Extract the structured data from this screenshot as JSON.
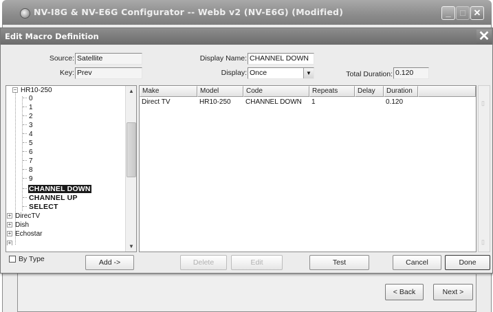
{
  "parent_window": {
    "title": "NV-I8G & NV-E6G Configurator -- Webb v2 (NV-E6G) (Modified)",
    "back_label": "< Back",
    "next_label": "Next >",
    "close_glyph": "✕"
  },
  "dialog": {
    "title": "Edit Macro Definition",
    "close_glyph": "✕",
    "source_label": "Source:",
    "source_value": "Satellite",
    "key_label": "Key:",
    "key_value": "Prev",
    "display_name_label": "Display Name:",
    "display_name_value": "CHANNEL DOWN",
    "display_label": "Display:",
    "display_value": "Once",
    "total_duration_label": "Total Duration:",
    "total_duration_value": "0.120"
  },
  "tree": {
    "root": "HR10-250",
    "children": [
      "0",
      "1",
      "2",
      "3",
      "4",
      "5",
      "6",
      "7",
      "8",
      "9",
      "CHANNEL DOWN",
      "CHANNEL UP",
      "SELECT"
    ],
    "selected": "CHANNEL DOWN",
    "siblings": [
      "DirecTV",
      "Dish",
      "Echostar"
    ]
  },
  "grid": {
    "columns": [
      "Make",
      "Model",
      "Code",
      "Repeats",
      "Delay",
      "Duration"
    ],
    "rows": [
      {
        "make": "Direct TV",
        "model": "HR10-250",
        "code": "CHANNEL DOWN",
        "repeats": "1",
        "delay": "",
        "duration": "0.120"
      }
    ]
  },
  "footer": {
    "by_type_label": "By Type",
    "add_label": "Add ->",
    "delete_label": "Delete",
    "edit_label": "Edit",
    "test_label": "Test",
    "cancel_label": "Cancel",
    "done_label": "Done"
  }
}
